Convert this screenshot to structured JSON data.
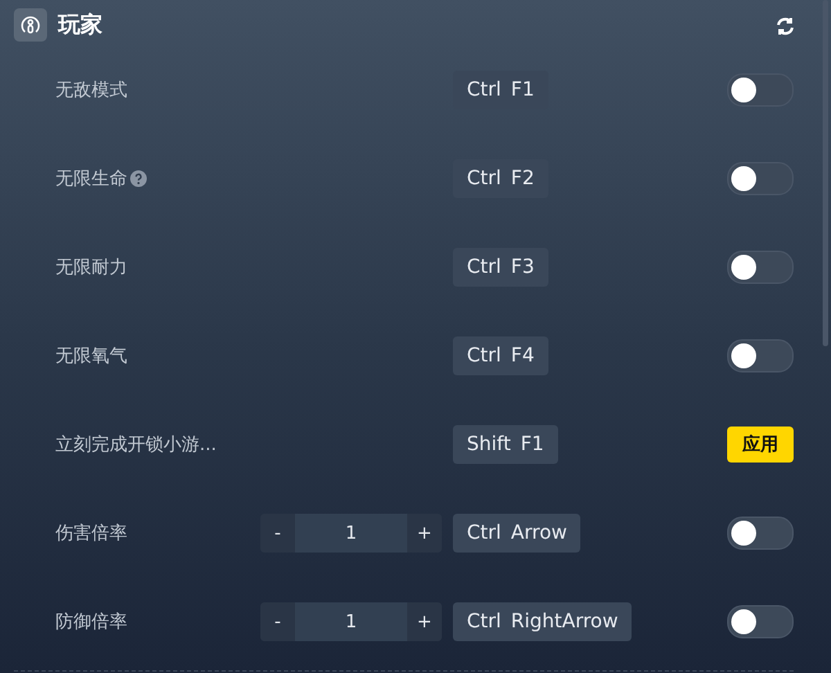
{
  "header": {
    "title": "玩家"
  },
  "rows": [
    {
      "label": "无敌模式",
      "help": false,
      "keys": [
        "Ctrl",
        "F1"
      ],
      "kind": "toggle",
      "on": false
    },
    {
      "label": "无限生命",
      "help": true,
      "keys": [
        "Ctrl",
        "F2"
      ],
      "kind": "toggle",
      "on": false
    },
    {
      "label": "无限耐力",
      "help": false,
      "keys": [
        "Ctrl",
        "F3"
      ],
      "kind": "toggle",
      "on": false
    },
    {
      "label": "无限氧气",
      "help": false,
      "keys": [
        "Ctrl",
        "F4"
      ],
      "kind": "toggle",
      "on": false
    },
    {
      "label": "立刻完成开锁小游...",
      "help": false,
      "keys": [
        "Shift",
        "F1"
      ],
      "kind": "button",
      "button": "应用"
    },
    {
      "label": "伤害倍率",
      "help": false,
      "stepper": {
        "minus": "-",
        "value": "1",
        "plus": "+"
      },
      "keys": [
        "Ctrl",
        "Arrow"
      ],
      "kind": "toggle",
      "on": false
    },
    {
      "label": "防御倍率",
      "help": false,
      "stepper": {
        "minus": "-",
        "value": "1",
        "plus": "+"
      },
      "keys": [
        "Ctrl",
        "RightArrow"
      ],
      "kind": "toggle",
      "on": false
    }
  ]
}
